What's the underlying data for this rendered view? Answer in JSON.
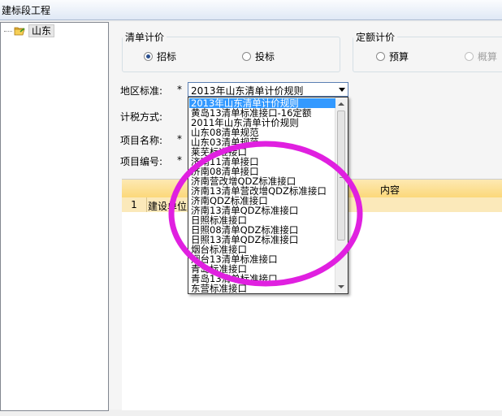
{
  "window": {
    "title": "建标段工程"
  },
  "tree": {
    "root_label": "山东"
  },
  "pricing_group": {
    "legend": "清单计价",
    "options": [
      {
        "label": "招标",
        "checked": true
      },
      {
        "label": "投标",
        "checked": false
      }
    ]
  },
  "quota_group": {
    "legend": "定额计价",
    "options": [
      {
        "label": "预算",
        "checked": false
      },
      {
        "label": "概算",
        "checked": false
      }
    ]
  },
  "form": {
    "region_label": "地区标准:",
    "required_mark": "*",
    "tax_label": "计税方式:",
    "name_label": "项目名称:",
    "code_label": "项目编号:",
    "region_value": "2013年山东清单计价规则"
  },
  "dropdown": {
    "items": [
      "2013年山东清单计价规则",
      "黄岛13清单标准接口-16定额",
      "2011年山东清单计价规则",
      "山东08清单规范",
      "山东03清单规范",
      "莱芜标准接口",
      "济南11清单接口",
      "济南08清单接口",
      "济南营改增QDZ标准接口",
      "济南13清单营改增QDZ标准接口",
      "济南QDZ标准接口",
      "济南13清单QDZ标准接口",
      "日照标准接口",
      "日照08清单QDZ标准接口",
      "日照13清单QDZ标准接口",
      "烟台标准接口",
      "烟台13清单标准接口",
      "青岛标准接口",
      "青岛13清单标准接口",
      "东营标准接口"
    ]
  },
  "grid": {
    "header_content": "内容",
    "rows": [
      {
        "num": "1",
        "cell": "建设单位"
      }
    ]
  },
  "colors": {
    "highlight": "#3399ff",
    "annotation": "#e020e0",
    "header_bg": "#fcd87a"
  }
}
